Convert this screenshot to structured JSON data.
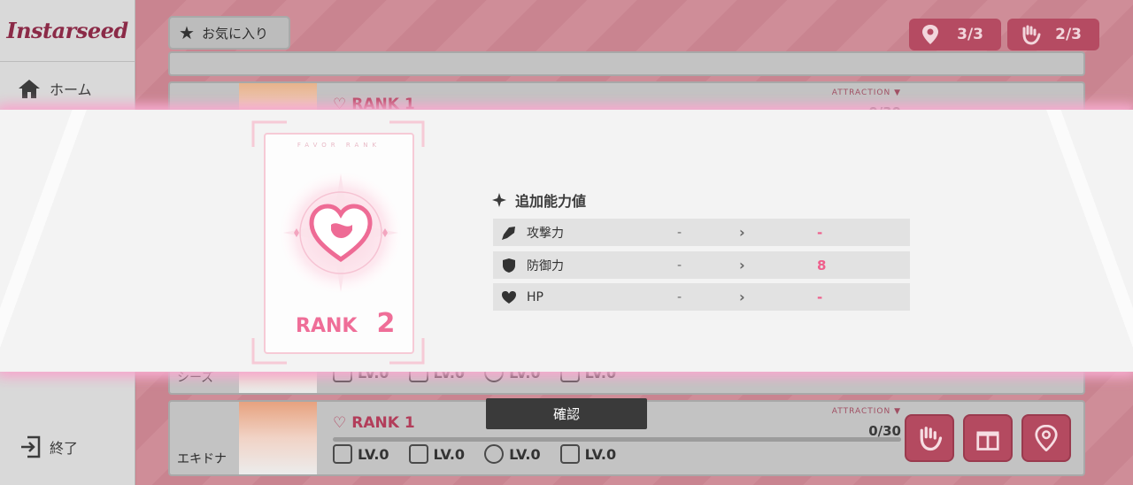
{
  "app": {
    "logo": "Instarseed"
  },
  "sidebar": {
    "home_label": "ホーム",
    "exit_label": "終了"
  },
  "header": {
    "favorites_label": "お気に入り",
    "location_count": "3/3",
    "touch_count": "2/3"
  },
  "characters": [
    {
      "name": "シーズ",
      "rank_label": "RANK",
      "rank_value": "1",
      "levels": [
        "LV.0",
        "LV.0",
        "LV.0",
        "LV.0"
      ]
    },
    {
      "name": "エキドナ",
      "rank_label": "RANK",
      "rank_value": "1",
      "attraction_label": "ATTRACTION ▼",
      "attraction_value": "0/30",
      "levels": [
        "LV.0",
        "LV.0",
        "LV.0",
        "LV.0"
      ]
    }
  ],
  "hidden_card": {
    "rank_label": "RANK",
    "rank_value": "1",
    "attraction_label": "ATTRACTION ▼",
    "attraction_value": "0/30"
  },
  "popup": {
    "favor_caption": "FAVOR RANK",
    "rank_label": "RANK",
    "rank_value": "2",
    "stats_title": "追加能力値",
    "stats": [
      {
        "icon": "sword-icon",
        "name": "攻撃力",
        "before": "-",
        "after": "-"
      },
      {
        "icon": "shield-icon",
        "name": "防御力",
        "before": "-",
        "after": "8"
      },
      {
        "icon": "heart-icon",
        "name": "HP",
        "before": "-",
        "after": "-"
      }
    ],
    "confirm_label": "確認"
  },
  "colors": {
    "accent": "#ef6e98",
    "button_dark": "#3a3a3a",
    "action": "#b44a60"
  }
}
